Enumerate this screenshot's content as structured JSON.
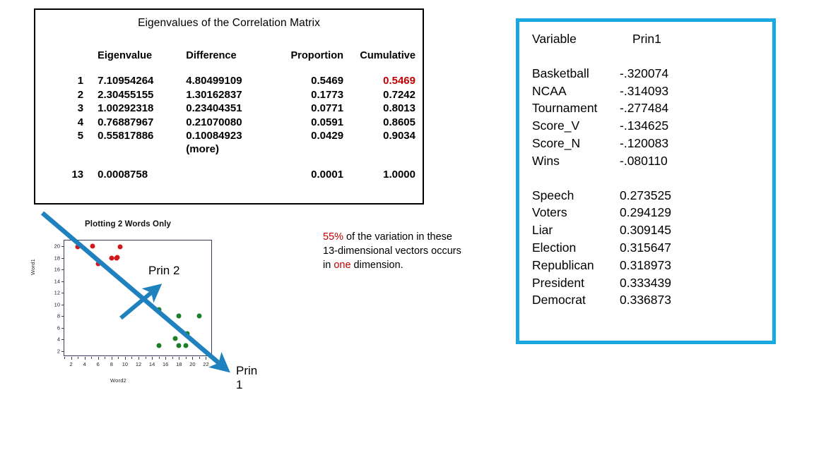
{
  "eigen_panel": {
    "title": "Eigenvalues of the Correlation Matrix",
    "headers": [
      "",
      "Eigenvalue",
      "Difference",
      "Proportion",
      "Cumulative"
    ],
    "rows": [
      {
        "idx": "1",
        "eigenvalue": "7.10954264",
        "difference": "4.80499109",
        "proportion": "0.5469",
        "cumulative": "0.5469",
        "cumulative_highlight": true
      },
      {
        "idx": "2",
        "eigenvalue": "2.30455155",
        "difference": "1.30162837",
        "proportion": "0.1773",
        "cumulative": "0.7242",
        "cumulative_highlight": false
      },
      {
        "idx": "3",
        "eigenvalue": "1.00292318",
        "difference": "0.23404351",
        "proportion": "0.0771",
        "cumulative": "0.8013",
        "cumulative_highlight": false
      },
      {
        "idx": "4",
        "eigenvalue": "0.76887967",
        "difference": "0.21070080",
        "proportion": "0.0591",
        "cumulative": "0.8605",
        "cumulative_highlight": false
      },
      {
        "idx": "5",
        "eigenvalue": "0.55817886",
        "difference": "0.10084923",
        "proportion": "0.0429",
        "cumulative": "0.9034",
        "cumulative_highlight": false
      }
    ],
    "more_label": "(more)",
    "last_row": {
      "idx": "13",
      "eigenvalue": "0.0008758",
      "difference": "",
      "proportion": "0.0001",
      "cumulative": "1.0000"
    }
  },
  "callout": {
    "part1": "55%",
    "part2": " of the variation in these 13-dimensional vectors occurs in ",
    "part3": "one",
    "part4": " dimension."
  },
  "loadings_panel": {
    "header_variable": "Variable",
    "header_component": "Prin1",
    "negative_rows": [
      {
        "name": "Basketball",
        "value": "-.320074"
      },
      {
        "name": "NCAA",
        "value": "-.314093"
      },
      {
        "name": "Tournament",
        "value": "-.277484"
      },
      {
        "name": "Score_V",
        "value": "-.134625"
      },
      {
        "name": "Score_N",
        "value": "-.120083"
      },
      {
        "name": "Wins",
        "value": "-.080110"
      }
    ],
    "positive_rows": [
      {
        "name": "Speech",
        "value": "0.273525"
      },
      {
        "name": "Voters",
        "value": "0.294129"
      },
      {
        "name": "Liar",
        "value": "0.309145"
      },
      {
        "name": "Election",
        "value": "0.315647"
      },
      {
        "name": "Republican",
        "value": "0.318973"
      },
      {
        "name": "President",
        "value": "0.333439"
      },
      {
        "name": "Democrat",
        "value": "0.336873"
      }
    ],
    "border_color": "#19A9E0"
  },
  "annotations": {
    "prin1_label": "Prin 1",
    "prin2_label": "Prin 2",
    "arrow_color": "#1F82BE"
  },
  "chart_data": {
    "type": "scatter",
    "title": "Plotting 2 Words Only",
    "xlabel": "Word2",
    "ylabel": "Word1",
    "xlim": [
      1,
      23
    ],
    "ylim": [
      1,
      21
    ],
    "xticks": [
      2,
      4,
      6,
      8,
      10,
      12,
      14,
      16,
      18,
      20,
      22
    ],
    "yticks": [
      2,
      4,
      6,
      8,
      10,
      12,
      14,
      16,
      18,
      20
    ],
    "grid": false,
    "legend": null,
    "series": [
      {
        "name": "group-red",
        "color": "#D21919",
        "points": [
          {
            "x": 3.0,
            "y": 19.9
          },
          {
            "x": 5.2,
            "y": 20.0
          },
          {
            "x": 6.0,
            "y": 17.0
          },
          {
            "x": 8.0,
            "y": 18.0
          },
          {
            "x": 8.7,
            "y": 18.0
          },
          {
            "x": 9.3,
            "y": 19.9
          },
          {
            "x": 8.9,
            "y": 18.1
          }
        ]
      },
      {
        "name": "group-green",
        "color": "#1A7F26",
        "points": [
          {
            "x": 15.0,
            "y": 9.1
          },
          {
            "x": 18.0,
            "y": 8.0
          },
          {
            "x": 21.0,
            "y": 8.0
          },
          {
            "x": 19.2,
            "y": 5.0
          },
          {
            "x": 17.4,
            "y": 4.1
          },
          {
            "x": 15.0,
            "y": 3.0
          },
          {
            "x": 18.0,
            "y": 2.9
          },
          {
            "x": 19.0,
            "y": 3.0
          }
        ]
      }
    ],
    "annotations": [
      {
        "label": "Prin 1",
        "type": "arrow",
        "direction": "down-right",
        "note": "first principal component axis"
      },
      {
        "label": "Prin 2",
        "type": "arrow",
        "direction": "up-right",
        "note": "second principal component axis"
      }
    ]
  }
}
